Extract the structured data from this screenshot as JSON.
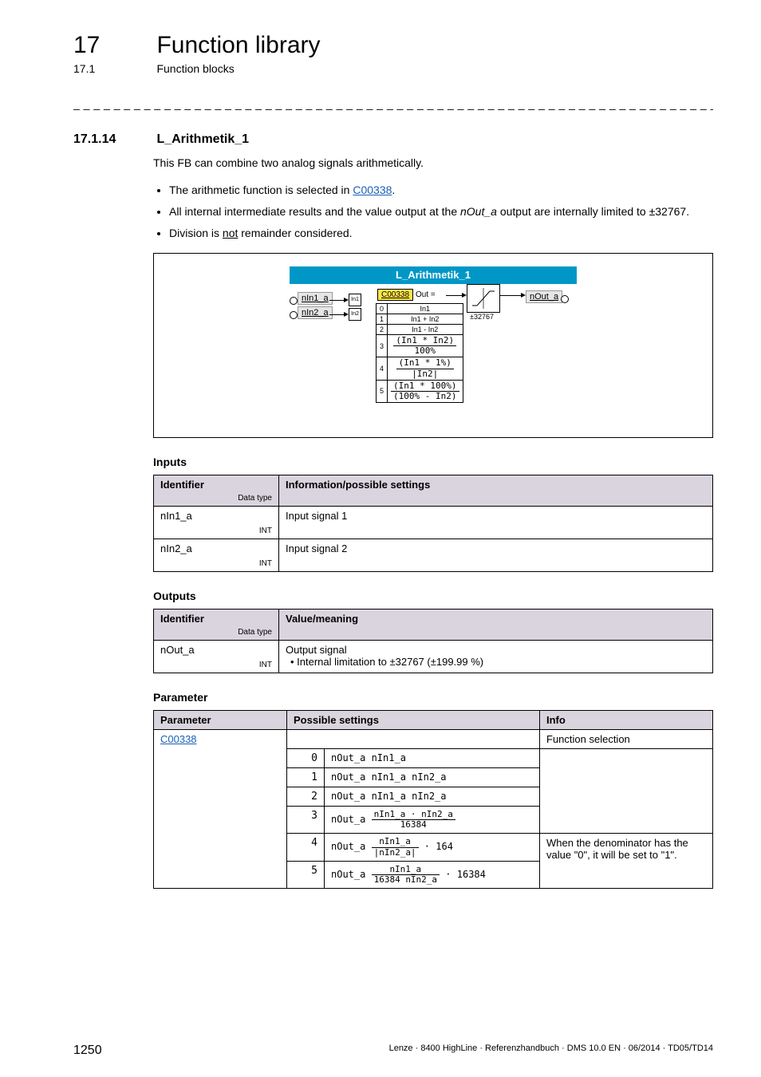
{
  "header": {
    "chapter_num": "17",
    "chapter_title": "Function library",
    "section_num": "17.1",
    "section_title": "Function blocks"
  },
  "separator": "_ _ _ _ _ _ _ _ _ _ _ _ _ _ _ _ _ _ _ _ _ _ _ _ _ _ _ _ _ _ _ _ _ _ _ _ _ _ _ _ _ _ _ _ _ _ _ _ _ _ _ _ _ _ _ _ _ _ _ _ _ _ _ _",
  "section": {
    "num": "17.1.14",
    "title": "L_Arithmetik_1"
  },
  "intro": {
    "lead": "This FB can combine two analog signals arithmetically.",
    "bullets": [
      {
        "pre": "The arithmetic function is selected in ",
        "link": "C00338",
        "post": "."
      },
      {
        "pre": "All internal intermediate results and the value output at the ",
        "ital": "nOut_a",
        "post": " output are internally limited to ±32767."
      },
      {
        "pre": "Division is ",
        "underline": "not",
        "post": " remainder considered."
      }
    ]
  },
  "diagram": {
    "title": "L_Arithmetik_1",
    "in1": "nIn1_a",
    "in2": "nIn2_a",
    "in1_pin": "In1",
    "in2_pin": "In2",
    "param": "C00338",
    "out_eq": "Out =",
    "options": [
      [
        "0",
        "In1"
      ],
      [
        "1",
        "In1 + In2"
      ],
      [
        "2",
        "In1 - In2"
      ],
      [
        "3",
        "(In1 * In2)\n100%"
      ],
      [
        "4",
        "(In1 * 1%)\n|In2|"
      ],
      [
        "5",
        "(In1 * 100%)\n(100% - In2)"
      ]
    ],
    "limit": "±32767",
    "out": "nOut_a"
  },
  "inputs_heading": "Inputs",
  "inputs_table": {
    "h1": "Identifier",
    "h1_sub": "Data type",
    "h2": "Information/possible settings",
    "rows": [
      {
        "id": "nIn1_a",
        "type": "INT",
        "info": "Input signal 1"
      },
      {
        "id": "nIn2_a",
        "type": "INT",
        "info": "Input signal 2"
      }
    ]
  },
  "outputs_heading": "Outputs",
  "outputs_table": {
    "h1": "Identifier",
    "h1_sub": "Data type",
    "h2": "Value/meaning",
    "rows": [
      {
        "id": "nOut_a",
        "type": "INT",
        "info1": "Output signal",
        "info2": "• Internal limitation to ±32767 (±199.99 %)"
      }
    ]
  },
  "param_heading": "Parameter",
  "param_table": {
    "h1": "Parameter",
    "h2": "Possible settings",
    "h3": "Info",
    "param_link": "C00338",
    "info_top": "Function selection",
    "rows": [
      {
        "n": "0",
        "formula_plain": "nOut_a  nIn1_a"
      },
      {
        "n": "1",
        "formula_plain": "nOut_a  nIn1_a  nIn2_a"
      },
      {
        "n": "2",
        "formula_plain": "nOut_a  nIn1_a  nIn2_a"
      },
      {
        "n": "3",
        "formula_frac": {
          "lead": "nOut_a  ",
          "top": "nIn1_a · nIn2_a",
          "bot": "16384"
        }
      },
      {
        "n": "4",
        "formula_frac": {
          "lead": "nOut_a  ",
          "top": "nIn1_a",
          "bot": "|nIn2_a|",
          "tail": " · 164"
        },
        "info": "When the denominator has the value \"0\", it will be set to \"1\"."
      },
      {
        "n": "5",
        "formula_frac": {
          "lead": "nOut_a  ",
          "top": "nIn1_a",
          "bot": "16384  nIn2_a",
          "tail": " · 16384"
        }
      }
    ]
  },
  "footer": {
    "page": "1250",
    "doc": "Lenze · 8400 HighLine · Referenzhandbuch · DMS 10.0 EN · 06/2014 · TD05/TD14"
  }
}
